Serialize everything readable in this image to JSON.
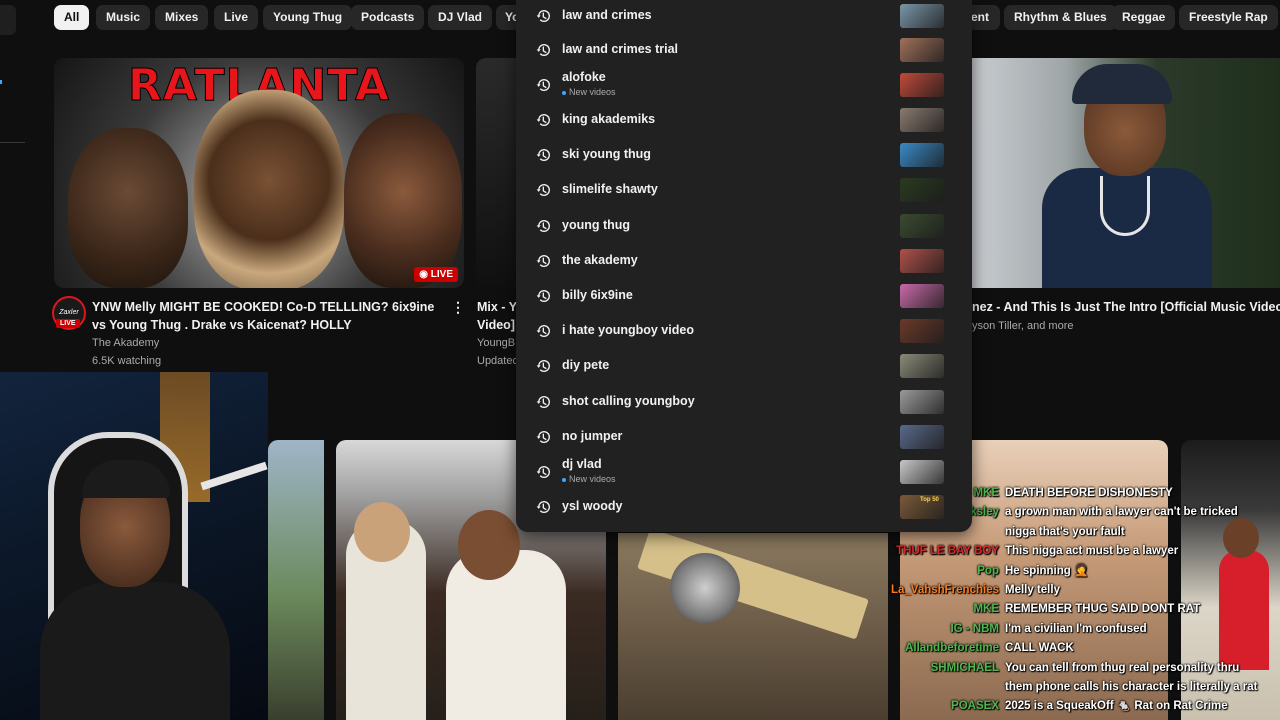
{
  "chips": [
    {
      "label": "All",
      "active": true
    },
    {
      "label": "Music"
    },
    {
      "label": "Mixes"
    },
    {
      "label": "Live"
    },
    {
      "label": "Young Thug"
    },
    {
      "label": "Podcasts"
    },
    {
      "label": "DJ Vlad"
    },
    {
      "label": "Yo"
    },
    {
      "label": "ent"
    },
    {
      "label": "Rhythm & Blues"
    },
    {
      "label": "Reggae"
    },
    {
      "label": "Freestyle Rap"
    }
  ],
  "video1": {
    "thumb_text": "RATLANTA",
    "live_badge": "LIVE",
    "avatar_text": "Zaxler",
    "avatar_live": "LIVE",
    "title": "YNW Melly MIGHT BE COOKED! Co-D TELLLING? 6ix9ine vs Young Thug . Drake vs Kaicenat? HOLLY",
    "channel": "The Akademy",
    "views": "6.5K watching",
    "menu": "⋮"
  },
  "video2": {
    "title_line1": "Mix - Y",
    "title_line2": "Video]",
    "channel": "YoungB",
    "updated": "Updatec"
  },
  "video3": {
    "title": "nez - And This Is Just The Intro [Official Music Video]",
    "channel": "yson Tiller, and more"
  },
  "suggestions": [
    {
      "text": "law and crimes",
      "thumb": "#7a96a8"
    },
    {
      "text": "law and crimes trial",
      "thumb": "#a0705a"
    },
    {
      "text": "alofoke",
      "sub": "New videos",
      "thumb": "#c04a3a"
    },
    {
      "text": "king akademiks",
      "thumb": "#8a7a70"
    },
    {
      "text": "ski young thug",
      "thumb": "#3a8ac8"
    },
    {
      "text": "slimelife shawty",
      "thumb": "#2a3a20"
    },
    {
      "text": "young thug",
      "thumb": "#3a4a30"
    },
    {
      "text": "the akademy",
      "thumb": "#b0504a"
    },
    {
      "text": "billy 6ix9ine",
      "thumb": "#c86aa8"
    },
    {
      "text": "i hate youngboy video",
      "thumb": "#6a3a2a"
    },
    {
      "text": "diy pete",
      "thumb": "#8a8a7a"
    },
    {
      "text": "shot calling youngboy",
      "thumb": "#9a9a9a"
    },
    {
      "text": "no jumper",
      "thumb": "#5a6a8a"
    },
    {
      "text": "dj vlad",
      "sub": "New videos",
      "thumb": "#c8c8c8"
    },
    {
      "text": "ysl woody",
      "thumb": "#7a5a3a",
      "thumb_text": "Top 50"
    }
  ],
  "chat": [
    {
      "user": "MKE",
      "user_color": "#4fb84f",
      "msg": "DEATH BEFORE DISHONESTY"
    },
    {
      "user": "Charles Locksley",
      "user_color": "#4fb84f",
      "msg": "a grown man with a lawyer can't be tricked"
    },
    {
      "user": "",
      "user_color": "#ffffff",
      "msg": "nigga that's your fault"
    },
    {
      "user": "THUF LE BAY BOY",
      "user_color": "#e0252b",
      "msg": "This nigga act must be a lawyer"
    },
    {
      "user": "Pop",
      "user_color": "#4fb84f",
      "msg": "He spinning 🤦"
    },
    {
      "user": "La_VahshFrenchies",
      "user_color": "#ff7a1a",
      "msg": "Melly telly"
    },
    {
      "user": "MKE",
      "user_color": "#4fb84f",
      "msg": "REMEMBER THUG SAID DONT RAT"
    },
    {
      "user": "IG - NBM",
      "user_color": "#4fb84f",
      "msg": "I'm a civilian I'm confused"
    },
    {
      "user": "Allandbeforetime",
      "user_color": "#4fb84f",
      "msg": "CALL WACK"
    },
    {
      "user": "SHMICHAEL",
      "user_color": "#4fb84f",
      "msg": "You can tell from thug real personality thru"
    },
    {
      "user": "",
      "user_color": "#ffffff",
      "msg": "them phone calls his character is literally a rat"
    },
    {
      "user": "POASEX",
      "user_color": "#4fb84f",
      "msg": "2025 is a SqueakOff 🐁 Rat on Rat Crime"
    }
  ]
}
